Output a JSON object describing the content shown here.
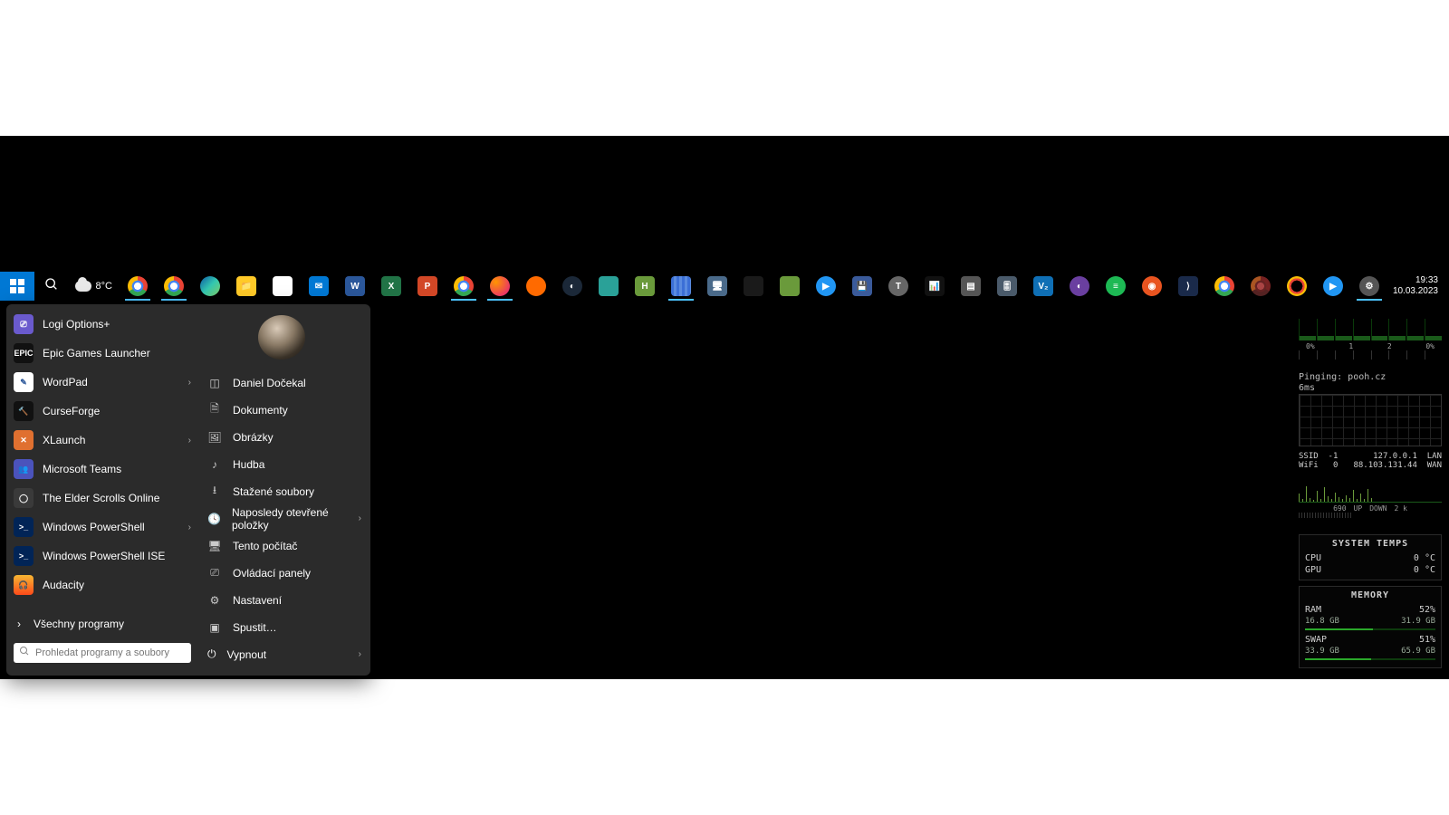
{
  "taskbar": {
    "weather_temp": "8°C",
    "clock_time": "19:33",
    "clock_date": "10.03.2023",
    "apps": [
      {
        "name": "chrome",
        "bg": "radial-gradient(circle,#fff 25%,#4285f4 26% 40%,transparent 41%),conic-gradient(#ea4335 0 120deg,#34a853 120deg 240deg,#fbbc05 240deg 360deg)",
        "round": true,
        "running": true
      },
      {
        "name": "chrome-alt",
        "bg": "radial-gradient(circle,#fff 25%,#4285f4 26% 40%,transparent 41%),conic-gradient(#ea4335 0 120deg,#34a853 120deg 240deg,#fbbc05 240deg 360deg)",
        "round": true,
        "running": true
      },
      {
        "name": "edge",
        "bg": "linear-gradient(135deg,#0c59a4,#33c7b0,#7fce68)",
        "round": true
      },
      {
        "name": "explorer",
        "bg": "#ffca28",
        "text": "📁"
      },
      {
        "name": "calendar",
        "bg": "#ffffff",
        "text": ""
      },
      {
        "name": "mail",
        "bg": "#0078d4",
        "text": "✉"
      },
      {
        "name": "word",
        "bg": "#2b579a",
        "text": "W"
      },
      {
        "name": "excel",
        "bg": "#217346",
        "text": "X"
      },
      {
        "name": "powerpoint",
        "bg": "#d24726",
        "text": "P"
      },
      {
        "name": "chrome-c",
        "bg": "radial-gradient(circle,#fff 25%,#4285f4 26% 40%,transparent 41%),conic-gradient(#ea4335 0 120deg,#34a853 120deg 240deg,#fbbc05 240deg 360deg)",
        "round": true,
        "running": true
      },
      {
        "name": "firefox",
        "bg": "radial-gradient(circle at 30% 30%,#ff9500,#e31587)",
        "round": true,
        "running": true
      },
      {
        "name": "app-orange",
        "bg": "#ff6a00",
        "round": true
      },
      {
        "name": "steam",
        "bg": "#1b2838",
        "round": true,
        "text": "◐"
      },
      {
        "name": "app-teal",
        "bg": "#2aa198"
      },
      {
        "name": "app-h",
        "bg": "#6a9a3b",
        "text": "H"
      },
      {
        "name": "app-blue-stripes",
        "bg": "repeating-linear-gradient(90deg,#3b6fd6 0 3px,#5a8be0 3px 6px)",
        "running": true
      },
      {
        "name": "app-monitor",
        "bg": "#4a6a8a",
        "text": "🖥"
      },
      {
        "name": "app-dark",
        "bg": "#1a1a1a"
      },
      {
        "name": "app-green-sq",
        "bg": "#6a9a3b"
      },
      {
        "name": "app-blue-play",
        "bg": "#2196f3",
        "round": true,
        "text": "▶"
      },
      {
        "name": "app-save",
        "bg": "#3a5a9a",
        "text": "💾"
      },
      {
        "name": "app-t",
        "bg": "#666",
        "round": true,
        "text": "T"
      },
      {
        "name": "app-bars",
        "bg": "#111",
        "text": "📊"
      },
      {
        "name": "app-doc",
        "bg": "#555",
        "text": "▤"
      },
      {
        "name": "app-mixer",
        "bg": "#4a5a6a",
        "text": "🎚"
      },
      {
        "name": "app-v2",
        "bg": "#0f6fb5",
        "text": "V₂"
      },
      {
        "name": "app-purple",
        "bg": "#6a3fa0",
        "round": true,
        "text": "◐"
      },
      {
        "name": "spotify",
        "bg": "#1db954",
        "round": true,
        "text": "≡"
      },
      {
        "name": "ubuntu",
        "bg": "#e95420",
        "round": true,
        "text": "◉"
      },
      {
        "name": "app-yellow-d",
        "bg": "#1a2a4a",
        "text": "⟩"
      },
      {
        "name": "chrome-d",
        "bg": "radial-gradient(circle,#fff 25%,#4285f4 26% 40%,transparent 41%),conic-gradient(#ea4335 0 120deg,#34a853 120deg 240deg,#fbbc05 240deg 360deg)",
        "round": true
      },
      {
        "name": "chrome-e",
        "bg": "radial-gradient(circle,#aa4444 25%,#662222 26% 40%,transparent 41%),conic-gradient(#772222 0 120deg,#552222 120deg 240deg,#aa5522 240deg 360deg)",
        "round": true
      },
      {
        "name": "app-ring",
        "bg": "radial-gradient(circle,#000 40%,#ea4335 41% 55%,#fbbc05 56% 70%,#34a853 71% 85%,#4285f4 86% 100%)",
        "round": true
      },
      {
        "name": "app-blue-play2",
        "bg": "#2196f3",
        "round": true,
        "text": "▶"
      },
      {
        "name": "settings-gear",
        "bg": "#555",
        "round": true,
        "text": "⚙",
        "running": true
      }
    ]
  },
  "start_menu": {
    "apps": [
      {
        "name": "Logi Options+",
        "bg": "#6a5acd",
        "text": "⎚"
      },
      {
        "name": "Epic Games Launcher",
        "bg": "#111",
        "text": "EPIC"
      },
      {
        "name": "WordPad",
        "bg": "#fff",
        "text": "✎",
        "arrow": true,
        "fg": "#2b579a"
      },
      {
        "name": "CurseForge",
        "bg": "#111",
        "text": "🔨"
      },
      {
        "name": "XLaunch",
        "bg": "#e07030",
        "text": "✕",
        "arrow": true
      },
      {
        "name": "Microsoft Teams",
        "bg": "#4b53bc",
        "text": "👥"
      },
      {
        "name": "The Elder Scrolls Online",
        "bg": "#3a3a3a",
        "text": "◯"
      },
      {
        "name": "Windows PowerShell",
        "bg": "#012456",
        "text": ">_",
        "arrow": true
      },
      {
        "name": "Windows PowerShell ISE",
        "bg": "#012456",
        "text": ">_"
      },
      {
        "name": "Audacity",
        "bg": "linear-gradient(#f7b733,#fc4a1a)",
        "text": "🎧"
      }
    ],
    "all_programs": "Všechny programy",
    "search_placeholder": "Prohledat programy a soubory",
    "user_name": "Daniel Dočekal",
    "links": [
      {
        "icon": "🗎",
        "label": "Dokumenty"
      },
      {
        "icon": "🖼",
        "label": "Obrázky"
      },
      {
        "icon": "♪",
        "label": "Hudba"
      },
      {
        "icon": "⭳",
        "label": "Stažené soubory"
      },
      {
        "icon": "🕓",
        "label": "Naposledy otevřené položky",
        "arrow": true
      },
      {
        "icon": "🖥",
        "label": "Tento počítač"
      },
      {
        "icon": "⎚",
        "label": "Ovládací panely"
      },
      {
        "icon": "⚙",
        "label": "Nastavení"
      },
      {
        "icon": "▣",
        "label": "Spustit…"
      }
    ],
    "power": "Vypnout"
  },
  "widgets": {
    "cpu_pct": [
      "0%",
      "1",
      "2",
      "0%"
    ],
    "ping_label": "Pinging: pooh.cz",
    "ping_ms": "6ms",
    "net": {
      "ssid": "SSID",
      "ssid_v": "-1",
      "lan_ip": "127.0.0.1",
      "lan": "LAN",
      "wifi": "WiFi",
      "wifi_v": "0",
      "wan_ip": "88.103.131.44",
      "wan": "WAN",
      "up_v": "690",
      "up": "UP",
      "down": "DOWN",
      "down_v": "2 k"
    },
    "temps": {
      "title": "SYSTEM TEMPS",
      "cpu": "CPU",
      "cpu_v": "0 °C",
      "gpu": "GPU",
      "gpu_v": "0 °C"
    },
    "memory": {
      "title": "MEMORY",
      "ram": "RAM",
      "ram_pct": "52%",
      "ram_used": "16.8 GB",
      "ram_total": "31.9 GB",
      "ram_fill": 52,
      "swap": "SWAP",
      "swap_pct": "51%",
      "swap_used": "33.9 GB",
      "swap_total": "65.9 GB",
      "swap_fill": 51
    }
  }
}
